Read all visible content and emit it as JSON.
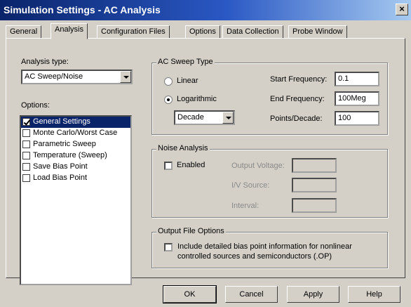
{
  "window": {
    "title": "Simulation Settings - AC Analysis",
    "close_label": "×"
  },
  "tabs": [
    {
      "label": "General"
    },
    {
      "label": "Analysis"
    },
    {
      "label": "Configuration Files"
    },
    {
      "label": "Options"
    },
    {
      "label": "Data Collection"
    },
    {
      "label": "Probe Window"
    }
  ],
  "analysis_type": {
    "label": "Analysis type:",
    "value": "AC Sweep/Noise"
  },
  "options": {
    "label": "Options:",
    "items": [
      {
        "label": "General Settings",
        "checked": true,
        "selected": true
      },
      {
        "label": "Monte Carlo/Worst Case",
        "checked": false
      },
      {
        "label": "Parametric Sweep",
        "checked": false
      },
      {
        "label": "Temperature (Sweep)",
        "checked": false
      },
      {
        "label": "Save Bias Point",
        "checked": false
      },
      {
        "label": "Load Bias Point",
        "checked": false
      }
    ]
  },
  "ac_sweep": {
    "title": "AC Sweep Type",
    "linear_label": "Linear",
    "log_label": "Logarithmic",
    "log_type": "Decade",
    "start_label": "Start Frequency:",
    "start_value": "0.1",
    "end_label": "End Frequency:",
    "end_value": "100Meg",
    "points_label": "Points/Decade:",
    "points_value": "100"
  },
  "noise": {
    "title": "Noise Analysis",
    "enabled_label": "Enabled",
    "output_voltage_label": "Output Voltage:",
    "iv_source_label": "I/V Source:",
    "interval_label": "Interval:"
  },
  "output_file": {
    "title": "Output File Options",
    "include_label_line1": "Include detailed bias point information for nonlinear",
    "include_label_line2": "controlled sources and semiconductors (.OP)"
  },
  "buttons": {
    "ok": "OK",
    "cancel": "Cancel",
    "apply": "Apply",
    "help": "Help"
  }
}
